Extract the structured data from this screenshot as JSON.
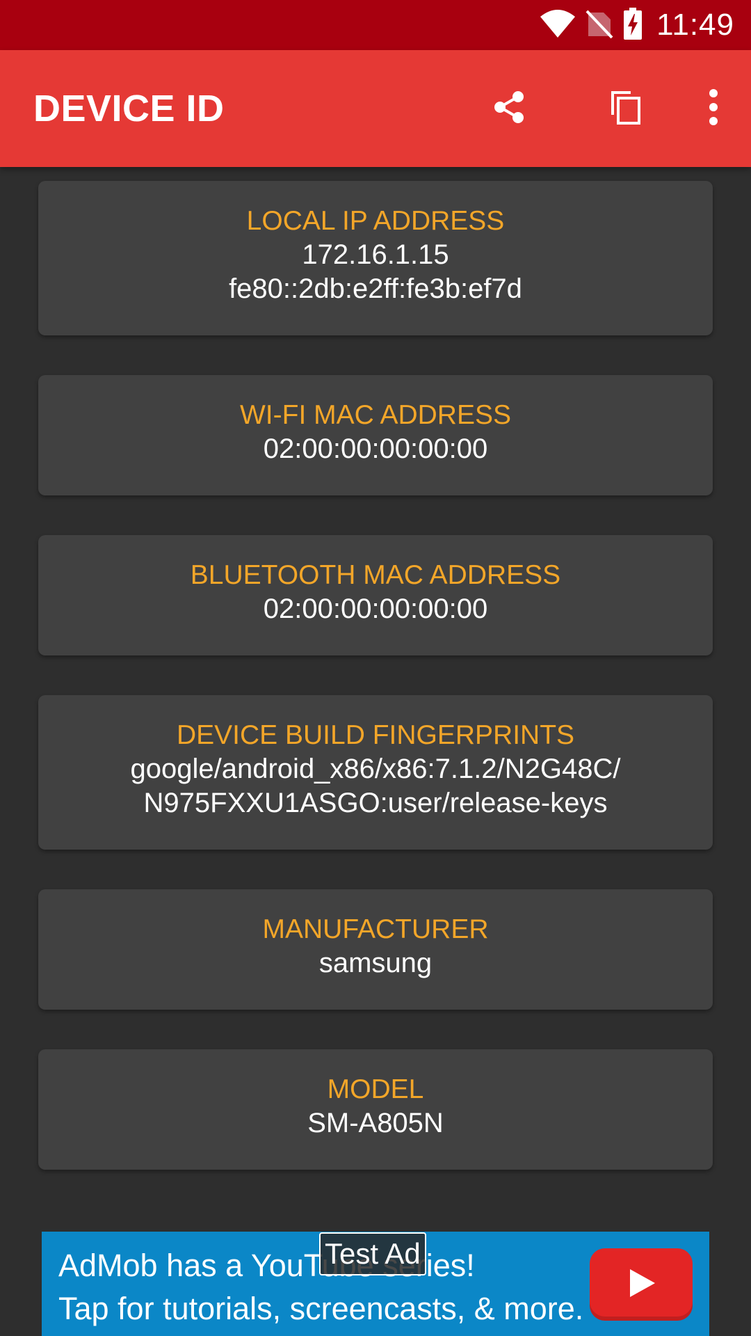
{
  "status_bar": {
    "time": "11:49",
    "icons": [
      "wifi-icon",
      "no-sim-icon",
      "battery-charging-icon"
    ]
  },
  "app_bar": {
    "title": "DEVICE ID",
    "actions": [
      "share-icon",
      "copy-icon",
      "more-vert-icon"
    ]
  },
  "cards": [
    {
      "label": "LOCAL IP ADDRESS",
      "value": "172.16.1.15\nfe80::2db:e2ff:fe3b:ef7d"
    },
    {
      "label": "WI-FI MAC ADDRESS",
      "value": "02:00:00:00:00:00"
    },
    {
      "label": "BLUETOOTH MAC ADDRESS",
      "value": "02:00:00:00:00:00"
    },
    {
      "label": "DEVICE BUILD FINGERPRINTS",
      "value": "google/android_x86/x86:7.1.2/N2G48C/\nN975FXXU1ASGO:user/release-keys"
    },
    {
      "label": "MANUFACTURER",
      "value": "samsung"
    },
    {
      "label": "MODEL",
      "value": "SM-A805N"
    }
  ],
  "ad": {
    "test_label": "Test Ad",
    "text": "AdMob has a YouTube series!\nTap for tutorials, screencasts, & more.",
    "icon": "youtube-play-icon"
  },
  "colors": {
    "status_bar": "#a8000f",
    "app_bar": "#e53935",
    "background": "#2e2e2e",
    "card": "#414141",
    "label": "#f3a629",
    "ad_background": "#0b87c7"
  }
}
